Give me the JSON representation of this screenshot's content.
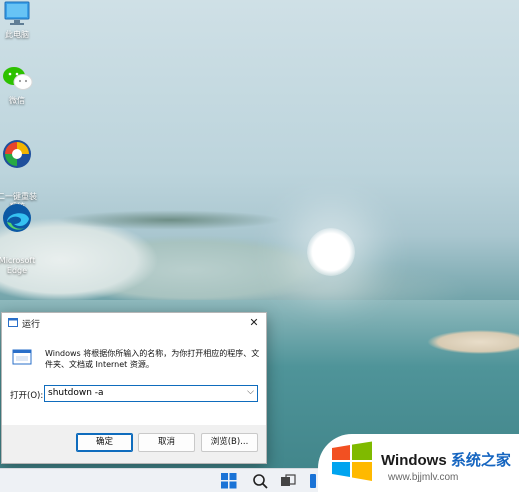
{
  "desktop": {
    "icons": [
      {
        "label": "此电脑",
        "icon": "this-pc-icon"
      },
      {
        "label": "微信",
        "icon": "wechat-icon"
      },
      {
        "label": "二一键重装\n系统",
        "icon": "reinstall-system-icon"
      },
      {
        "label": "Microsoft\nEdge",
        "icon": "edge-icon"
      }
    ]
  },
  "run_dialog": {
    "title": "运行",
    "description": "Windows 将根据你所输入的名称，为你打开相应的程序、文件夹、文档或 Internet 资源。",
    "open_label": "打开(O):",
    "input_value": "shutdown -a",
    "buttons": {
      "ok": "确定",
      "cancel": "取消",
      "browse": "浏览(B)..."
    },
    "accent_color": "#0f6cbd"
  },
  "taskbar": {
    "items": [
      "start-icon",
      "search-icon",
      "task-view-icon",
      "widgets-icon"
    ]
  },
  "watermark": {
    "brand": "Windows",
    "brand_cn": "系统之家",
    "url": "www.bjjmlv.com"
  }
}
